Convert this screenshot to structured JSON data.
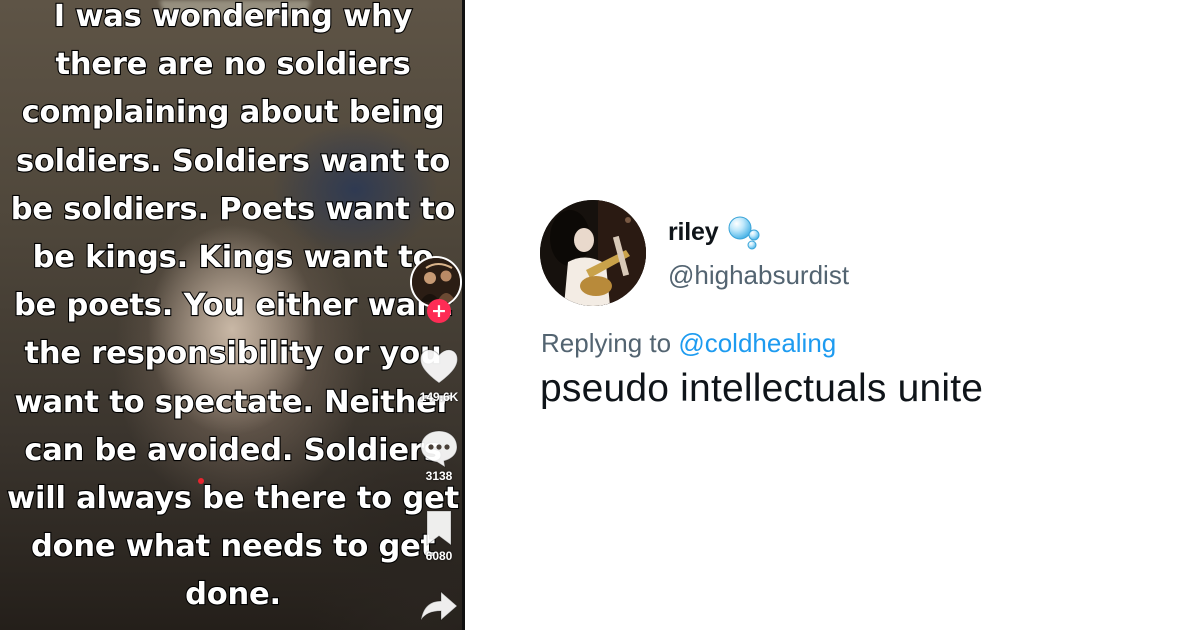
{
  "tiktok": {
    "caption": "I was wondering why\nthere are no soldiers\ncomplaining about being\nsoldiers. Soldiers want to\nbe soldiers. Poets want to\nbe kings. Kings want to\nbe poets. You either want\nthe responsibility or you\nwant to spectate. Neither\ncan be avoided. Soldiers\nwill always be there to get\ndone what needs to get\ndone.",
    "follow_symbol": "+",
    "likes": "149.6K",
    "comments": "3138",
    "bookmarks": "6080",
    "icons": [
      "avatar",
      "plus-icon",
      "heart-icon",
      "comment-icon",
      "bookmark-icon",
      "share-icon"
    ],
    "accent_color": "#fe2c55"
  },
  "tweet": {
    "display_name": "riley",
    "name_emoji": "bubbles-icon",
    "handle": "@highabsurdist",
    "replying_prefix": "Replying to",
    "replying_to": "@coldhealing",
    "text": "pseudo intellectuals unite",
    "colors": {
      "text": "#0f1419",
      "secondary": "#536471",
      "link": "#1d9bf0"
    }
  }
}
